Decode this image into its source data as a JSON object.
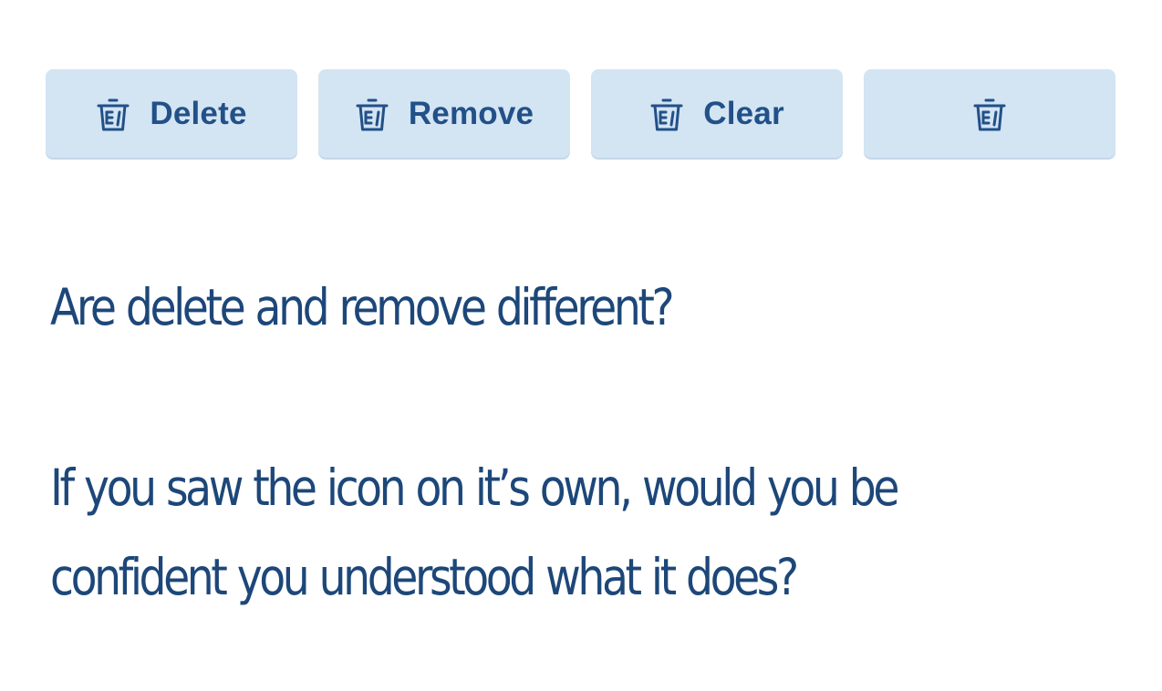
{
  "buttons": [
    {
      "label": "Delete",
      "icon": "trash-icon"
    },
    {
      "label": "Remove",
      "icon": "trash-icon"
    },
    {
      "label": "Clear",
      "icon": "trash-icon"
    },
    {
      "label": "",
      "icon": "trash-icon"
    }
  ],
  "questions": {
    "first": "Are delete and remove different?",
    "second": "If you saw the icon on it’s own, would you be confident you understood what it does?"
  },
  "colors": {
    "button_background": "#d3e4f3",
    "button_text": "#225088",
    "question_text": "#1d4779",
    "page_background": "#ffffff"
  }
}
